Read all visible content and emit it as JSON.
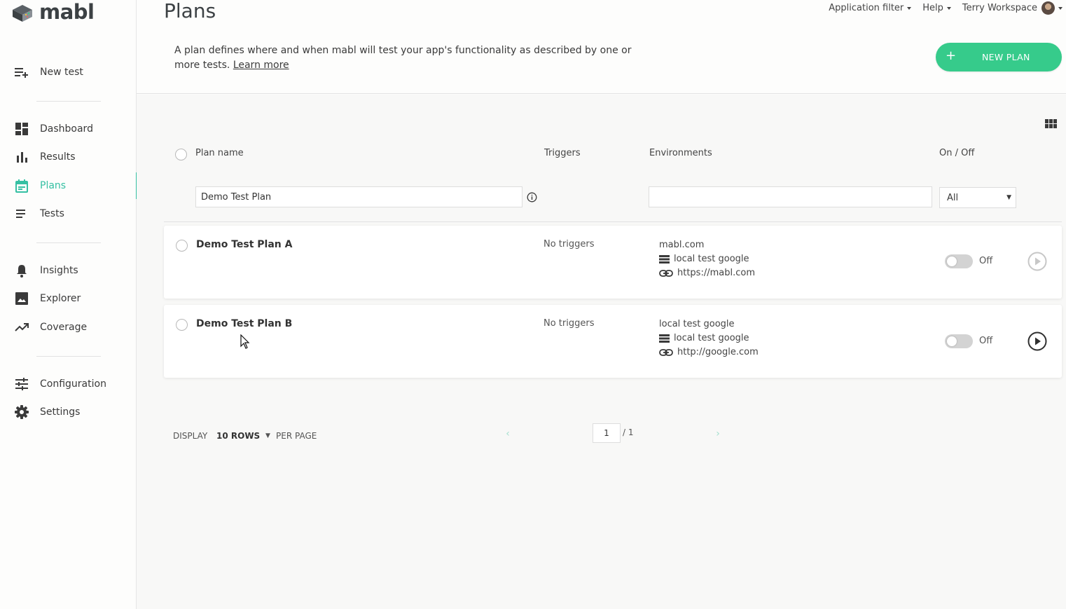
{
  "brand": {
    "name": "mabl"
  },
  "sidebar": {
    "new_test": "New test",
    "items": [
      {
        "label": "Dashboard",
        "icon": "dashboard-icon"
      },
      {
        "label": "Results",
        "icon": "bar-chart-icon"
      },
      {
        "label": "Plans",
        "icon": "calendar-icon",
        "active": true
      },
      {
        "label": "Tests",
        "icon": "list-icon"
      },
      {
        "label": "Insights",
        "icon": "bell-icon"
      },
      {
        "label": "Explorer",
        "icon": "image-icon"
      },
      {
        "label": "Coverage",
        "icon": "trending-up-icon"
      },
      {
        "label": "Configuration",
        "icon": "sliders-icon"
      },
      {
        "label": "Settings",
        "icon": "gear-icon"
      }
    ]
  },
  "header": {
    "title": "Plans",
    "menu": {
      "app_filter": "Application filter",
      "help": "Help",
      "workspace": "Terry Workspace"
    },
    "description": "A plan defines where and when mabl will test your app's functionality as described by one or more tests.",
    "learn_more": "Learn more",
    "new_plan_plus": "+",
    "new_plan": "NEW PLAN",
    "accent": "#36cb8b"
  },
  "table": {
    "columns": {
      "plan_name": "Plan name",
      "triggers": "Triggers",
      "environments": "Environments",
      "on_off": "On / Off"
    },
    "filters": {
      "plan_name_value": "Demo Test Plan",
      "environment_value": "",
      "on_off_value": "All"
    },
    "rows": [
      {
        "name": "Demo Test Plan A",
        "triggers": "No triggers",
        "env_name": "mabl.com",
        "env_credential": "local test google",
        "env_url": "https://mabl.com",
        "state": "Off"
      },
      {
        "name": "Demo Test Plan B",
        "triggers": "No triggers",
        "env_name": "local test google",
        "env_credential": "local test google",
        "env_url": "http://google.com",
        "state": "Off"
      }
    ]
  },
  "pagination": {
    "display": "DISPLAY",
    "rows": "10 ROWS",
    "per_page": "PER PAGE",
    "page": "1",
    "total": "/ 1"
  }
}
